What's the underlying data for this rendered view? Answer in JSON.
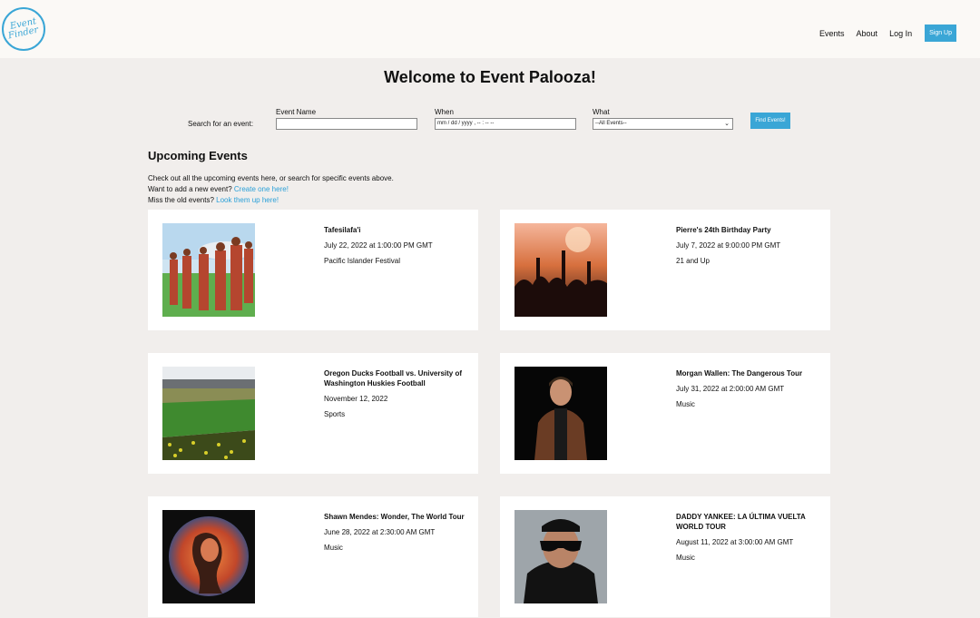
{
  "header": {
    "logo_line1": "Event",
    "logo_line2": "Finder",
    "nav": [
      "Events",
      "About",
      "Log In"
    ],
    "signup": "Sign Up"
  },
  "page_title": "Welcome to Event Palooza!",
  "search": {
    "label": "Search for an event:",
    "event_name_label": "Event Name",
    "event_name_value": "",
    "when_label": "When",
    "when_placeholder": "mm / dd / yyyy ,  -- : --   --",
    "what_label": "What",
    "what_selected": "--All Events--",
    "button": "Find Events!"
  },
  "upcoming": {
    "title": "Upcoming Events",
    "line1": "Check out all the upcoming events here, or search for specific events above.",
    "line2_text": "Want to add a new event? ",
    "line2_link": "Create one here!",
    "line3_text": "Miss the old events? ",
    "line3_link": "Look them up here!"
  },
  "events": [
    {
      "title": "Tafesilafa'i",
      "date": "July 22, 2022 at 1:00:00 PM GMT",
      "category": "Pacific Islander Festival"
    },
    {
      "title": "Pierre's 24th Birthday Party",
      "date": "July 7, 2022 at 9:00:00 PM GMT",
      "category": "21 and Up"
    },
    {
      "title": "Oregon Ducks Football vs. University of Washington Huskies Football",
      "date": "November 12, 2022",
      "category": "Sports"
    },
    {
      "title": "Morgan Wallen: The Dangerous Tour",
      "date": "July 31, 2022 at 2:00:00 AM GMT",
      "category": "Music"
    },
    {
      "title": "Shawn Mendes: Wonder, The World Tour",
      "date": "June 28, 2022 at 2:30:00 AM GMT",
      "category": "Music"
    },
    {
      "title": "DADDY YANKEE: LA ÚLTIMA VUELTA WORLD TOUR",
      "date": "August 11, 2022 at 3:00:00 AM GMT",
      "category": "Music"
    }
  ],
  "colors": {
    "accent": "#3aa6d6",
    "background": "#f1eeec",
    "card": "#ffffff"
  }
}
